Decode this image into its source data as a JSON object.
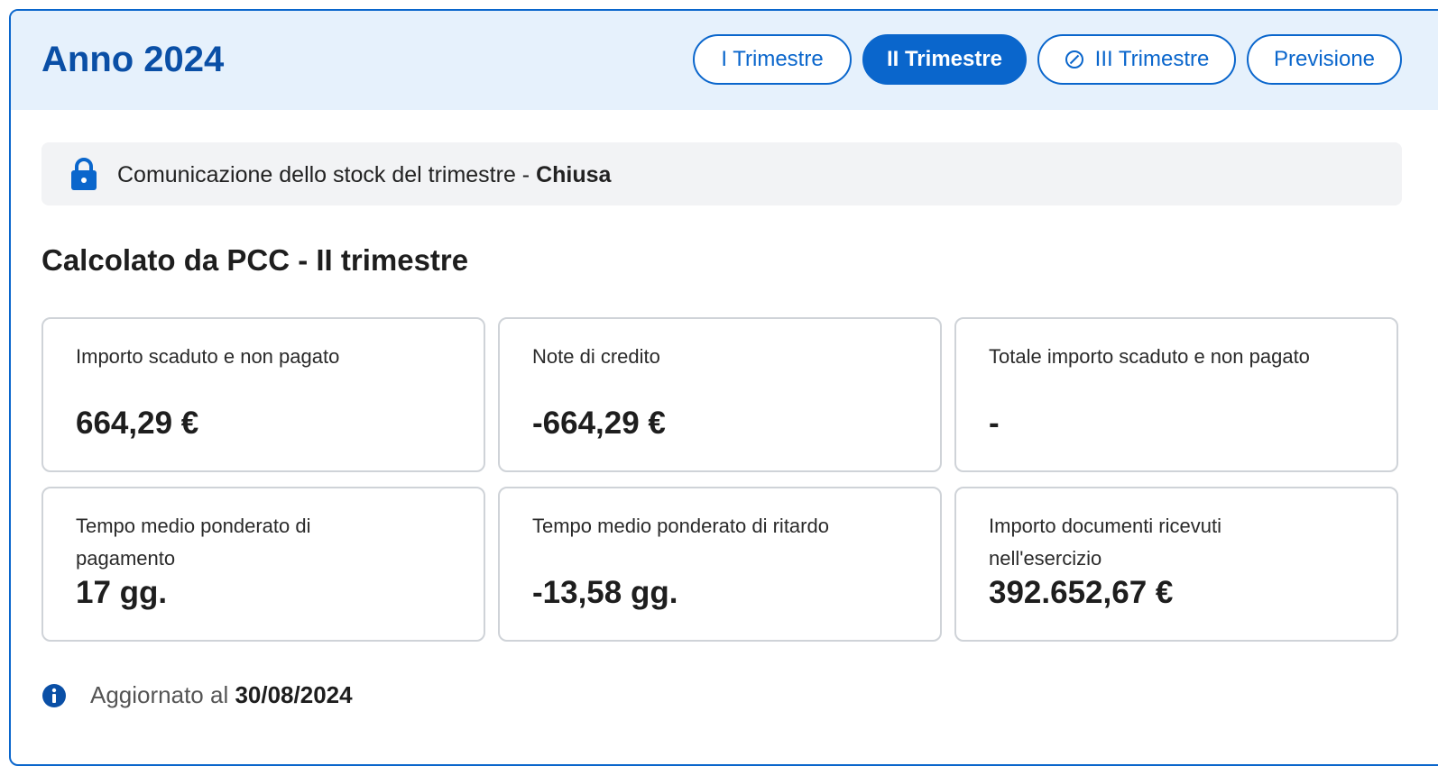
{
  "header": {
    "title": "Anno 2024",
    "tabs": [
      {
        "label": "I Trimestre",
        "active": false,
        "icon": ""
      },
      {
        "label": "II Trimestre",
        "active": true,
        "icon": ""
      },
      {
        "label": "III Trimestre",
        "active": false,
        "icon": "ban-icon"
      },
      {
        "label": "Previsione",
        "active": false,
        "icon": ""
      }
    ]
  },
  "status": {
    "icon": "lock-icon",
    "text": "Comunicazione dello stock del trimestre - ",
    "state": "Chiusa"
  },
  "section": {
    "title": "Calcolato da PCC - II trimestre"
  },
  "cards": [
    {
      "label": "Importo scaduto e non pagato",
      "value": "664,29 €"
    },
    {
      "label": "Note di credito",
      "value": "-664,29 €"
    },
    {
      "label": "Totale importo scaduto e non pagato",
      "value": "-"
    },
    {
      "label": "Tempo medio ponderato di pagamento",
      "value": "17 gg."
    },
    {
      "label": "Tempo medio ponderato di ritardo",
      "value": "-13,58 gg."
    },
    {
      "label": "Importo documenti ricevuti nell'esercizio",
      "value": "392.652,67 €"
    }
  ],
  "footer": {
    "icon": "info-icon",
    "label": "Aggiornato al ",
    "date": "30/08/2024"
  },
  "colors": {
    "primary": "#0a66cc",
    "header_bg": "#e6f1fc",
    "status_bg": "#f2f3f5"
  }
}
